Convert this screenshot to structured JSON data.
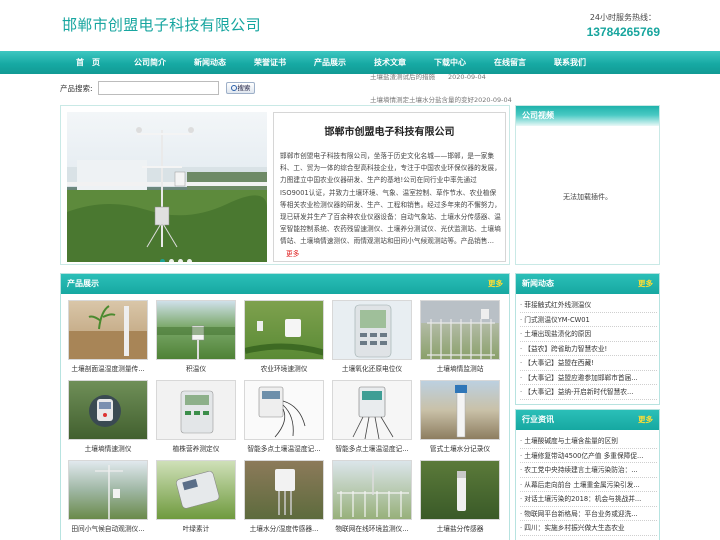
{
  "header": {
    "site_title": "邯郸市创盟电子科技有限公司",
    "hotline_label": "24小时服务热线：",
    "hotline_number": "13784265769"
  },
  "nav": [
    {
      "label": "首　页"
    },
    {
      "label": "公司简介"
    },
    {
      "label": "新闻动态"
    },
    {
      "label": "荣誉证书"
    },
    {
      "label": "产品展示"
    },
    {
      "label": "技术文章"
    },
    {
      "label": "下载中心"
    },
    {
      "label": "在线留言"
    },
    {
      "label": "联系我们"
    }
  ],
  "ticker": [
    "土壤盐渣测试后的措施　　2020-09-04",
    "土壤墒情测定土壤水分盐含量的变好2020-09-04"
  ],
  "search": {
    "label": "产品搜索:",
    "value": "",
    "button": "搜索"
  },
  "intro": {
    "company_name": "邯郸市创盟电子科技有限公司",
    "description": "邯郸市创盟电子科技有限公司，坐落于历史文化名城——邯郸，是一家集科、工、贸为一体的综合型高科技企业，专注于中国农业环保仪器的发展，力图建立中国农业仪器研发、生产的基地!公司在同行业中率先通过ISO9001认证，并致力土壤环境、气象、温室控制、草作节水、农业植保等相关农业检测仪器的研发、生产、工程和销售。经过多年来的不懈努力，现已研发并生产了百余种农业仪器设备：自动气象站、土壤水分传感器、温室智能控制系统、农药残留速测仪、土壤养分测试仪、光伏监测站、土壤墒情站、土壤墒情速测仪、雨情观测站和田间小气候观测站等。产品销售...",
    "more": "更多"
  },
  "video": {
    "title": "公司视频",
    "message": "无法加载插件。"
  },
  "products": {
    "title": "产品展示",
    "more": "更多",
    "items": [
      {
        "name": "土壤剖面温湿度测量传..."
      },
      {
        "name": "积温仪"
      },
      {
        "name": "农业环境速测仪"
      },
      {
        "name": "土壤氧化还原电位仪"
      },
      {
        "name": "土壤墒情监测站"
      },
      {
        "name": "土壤墒情速测仪"
      },
      {
        "name": "植株营养测定仪"
      },
      {
        "name": "智能多点土壤温湿度记..."
      },
      {
        "name": "智能多点土壤温湿度记..."
      },
      {
        "name": "管式土壤水分记录仪"
      },
      {
        "name": "田间小气候自动观测仪..."
      },
      {
        "name": "叶绿素计"
      },
      {
        "name": "土壤水分/湿度传感器..."
      },
      {
        "name": "物联网在线环境监测仪..."
      },
      {
        "name": "土壤盐分传感器"
      }
    ]
  },
  "news": {
    "title": "新闻动态",
    "more": "更多",
    "items": [
      "菲接触式红外线测温仪",
      "门式测温仪YM-CW01",
      "土壤出现盐渍化的原因",
      "【益农】跨省助力智慧农业!",
      "【大事记】益盟在西藏!",
      "【大事记】益盟应邀参加邯郸市首届...",
      "【大事记】益纳-开启新时代智慧农..."
    ]
  },
  "industry": {
    "title": "行业资讯",
    "more": "更多",
    "items": [
      "土壤酸碱度与土壤含盐量的区别",
      "土壤修复带动4500亿产值 多重保障促...",
      "农工党中央持续建言土壤污染防治：...",
      "从幕后走向前台 土壤重金属污染引发...",
      "对话土壤污染的2018：机会与挑战并...",
      "物联网平台新格局：平台业务或迎洗...",
      "四川：实施乡村振兴做大生态农业"
    ]
  }
}
